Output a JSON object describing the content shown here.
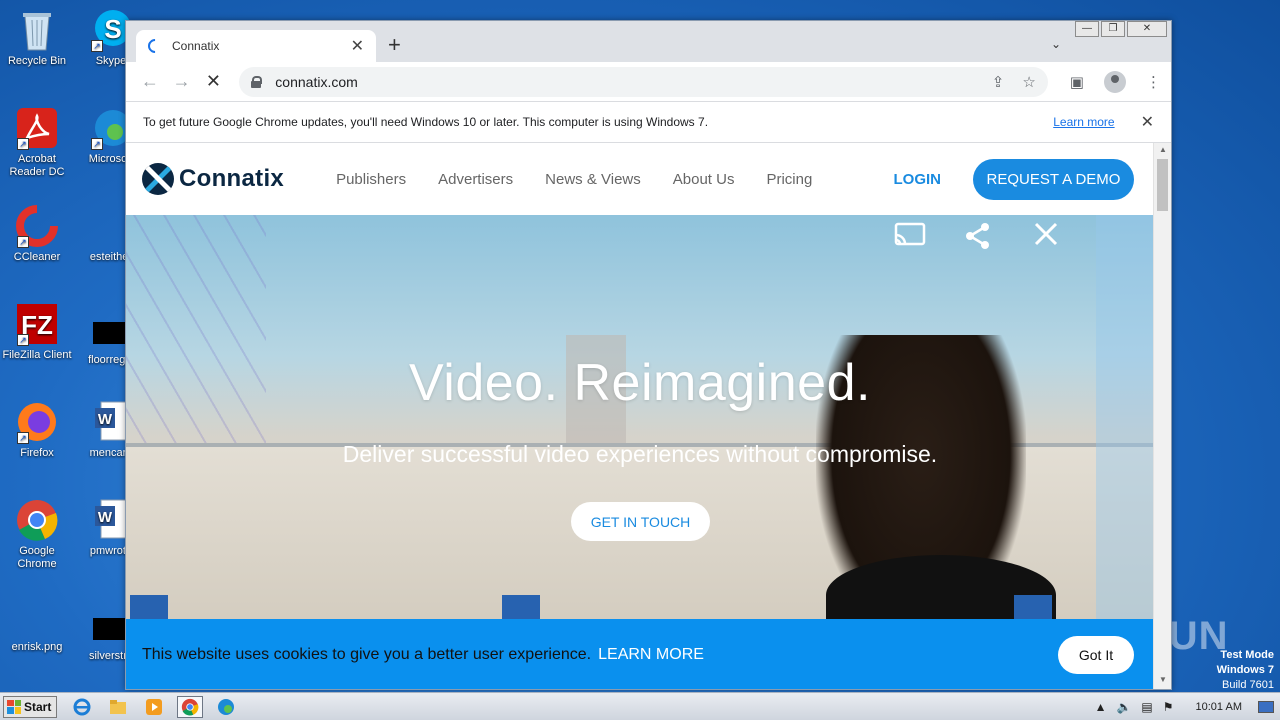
{
  "desktop": {
    "icons": [
      {
        "label": "Recycle Bin"
      },
      {
        "label": "Skype"
      },
      {
        "label": "Acrobat Reader DC"
      },
      {
        "label": "Microsoft"
      },
      {
        "label": "CCleaner"
      },
      {
        "label": "esteither"
      },
      {
        "label": "FileZilla Client"
      },
      {
        "label": "floorregai"
      },
      {
        "label": "Firefox"
      },
      {
        "label": "mencare"
      },
      {
        "label": "Google Chrome"
      },
      {
        "label": "pmwrote"
      },
      {
        "label": "enrisk.png"
      },
      {
        "label": "silverstru"
      }
    ],
    "watermark": "ANY RUN",
    "test_mode": {
      "line1": "Test Mode",
      "line2": "Windows 7",
      "line3": "Build 7601"
    }
  },
  "browser": {
    "tab_title": "Connatix",
    "url": "connatix.com",
    "infobar": {
      "message": "To get future Google Chrome updates, you'll need Windows 10 or later. This computer is using Windows 7.",
      "learn_more": "Learn more"
    }
  },
  "site": {
    "logo_text": "Connatix",
    "nav": [
      "Publishers",
      "Advertisers",
      "News & Views",
      "About Us",
      "Pricing"
    ],
    "login": "LOGIN",
    "demo": "REQUEST A DEMO",
    "hero_title": "Video. Reimagined.",
    "hero_subtitle": "Deliver successful video experiences without compromise.",
    "hero_cta": "GET IN TOUCH",
    "cookie_text": "This website uses cookies to give you a better user experience.",
    "cookie_learn": "LEARN MORE",
    "cookie_ok": "Got It"
  },
  "taskbar": {
    "start": "Start",
    "time": "10:01 AM"
  }
}
